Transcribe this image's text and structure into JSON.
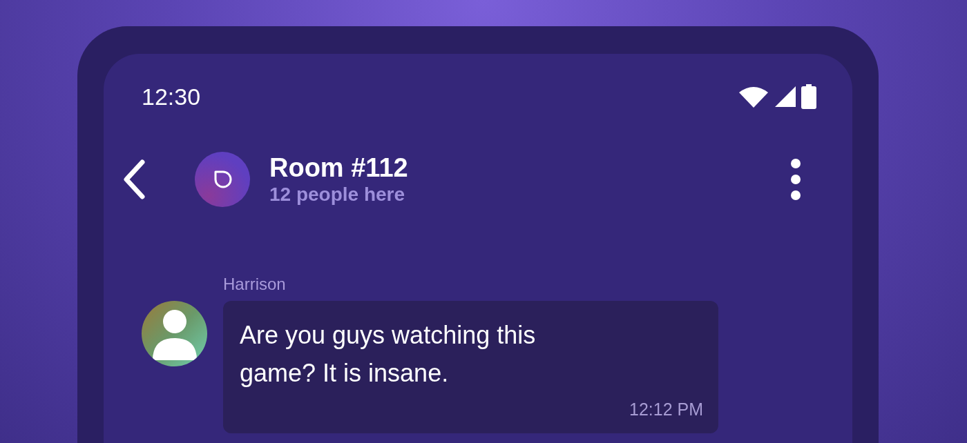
{
  "status_bar": {
    "time": "12:30"
  },
  "header": {
    "title": "Room #112",
    "subtitle": "12 people here"
  },
  "messages": [
    {
      "sender": "Harrison",
      "text": "Are you guys watching this game? It is insane.",
      "time": "12:12 PM"
    }
  ]
}
